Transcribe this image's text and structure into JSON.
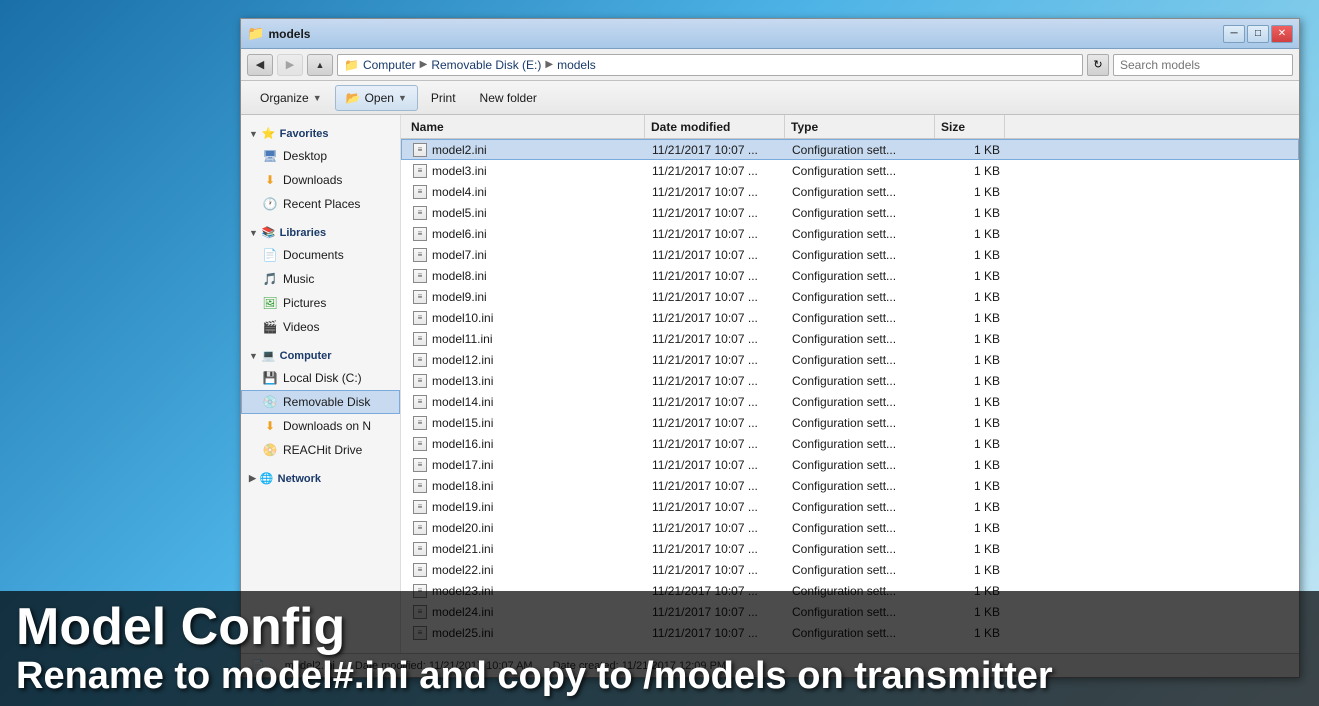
{
  "window": {
    "title": "models",
    "title_bar_title": "models"
  },
  "address": {
    "back_tooltip": "Back",
    "forward_tooltip": "Forward",
    "path": "Computer > Removable Disk (E:) > models",
    "path_segments": [
      "Computer",
      "Removable Disk (E:)",
      "models"
    ],
    "search_placeholder": "Search models",
    "refresh_label": "↻"
  },
  "toolbar": {
    "organize_label": "Organize",
    "open_label": "Open",
    "print_label": "Print",
    "new_folder_label": "New folder"
  },
  "sidebar": {
    "favorites_label": "Favorites",
    "favorites_items": [
      {
        "label": "Desktop",
        "icon": "desktop"
      },
      {
        "label": "Downloads",
        "icon": "downloads"
      },
      {
        "label": "Recent Places",
        "icon": "recent"
      }
    ],
    "libraries_label": "Libraries",
    "libraries_items": [
      {
        "label": "Documents",
        "icon": "docs"
      },
      {
        "label": "Music",
        "icon": "music"
      },
      {
        "label": "Pictures",
        "icon": "pictures"
      },
      {
        "label": "Videos",
        "icon": "videos"
      }
    ],
    "computer_label": "Computer",
    "computer_items": [
      {
        "label": "Local Disk (C:)",
        "icon": "local-disk"
      },
      {
        "label": "Removable Disk",
        "icon": "removable",
        "active": true
      },
      {
        "label": "Downloads on N",
        "icon": "downloads"
      },
      {
        "label": "REACHit Drive",
        "icon": "network"
      }
    ],
    "network_label": "Network"
  },
  "columns": {
    "name": "Name",
    "date_modified": "Date modified",
    "type": "Type",
    "size": "Size"
  },
  "files": [
    {
      "name": "model2.ini",
      "date": "11/21/2017 10:07 ...",
      "type": "Configuration sett...",
      "size": "1 KB",
      "selected": true
    },
    {
      "name": "model3.ini",
      "date": "11/21/2017 10:07 ...",
      "type": "Configuration sett...",
      "size": "1 KB"
    },
    {
      "name": "model4.ini",
      "date": "11/21/2017 10:07 ...",
      "type": "Configuration sett...",
      "size": "1 KB"
    },
    {
      "name": "model5.ini",
      "date": "11/21/2017 10:07 ...",
      "type": "Configuration sett...",
      "size": "1 KB"
    },
    {
      "name": "model6.ini",
      "date": "11/21/2017 10:07 ...",
      "type": "Configuration sett...",
      "size": "1 KB"
    },
    {
      "name": "model7.ini",
      "date": "11/21/2017 10:07 ...",
      "type": "Configuration sett...",
      "size": "1 KB"
    },
    {
      "name": "model8.ini",
      "date": "11/21/2017 10:07 ...",
      "type": "Configuration sett...",
      "size": "1 KB"
    },
    {
      "name": "model9.ini",
      "date": "11/21/2017 10:07 ...",
      "type": "Configuration sett...",
      "size": "1 KB"
    },
    {
      "name": "model10.ini",
      "date": "11/21/2017 10:07 ...",
      "type": "Configuration sett...",
      "size": "1 KB"
    },
    {
      "name": "model11.ini",
      "date": "11/21/2017 10:07 ...",
      "type": "Configuration sett...",
      "size": "1 KB"
    },
    {
      "name": "model12.ini",
      "date": "11/21/2017 10:07 ...",
      "type": "Configuration sett...",
      "size": "1 KB"
    },
    {
      "name": "model13.ini",
      "date": "11/21/2017 10:07 ...",
      "type": "Configuration sett...",
      "size": "1 KB"
    },
    {
      "name": "model14.ini",
      "date": "11/21/2017 10:07 ...",
      "type": "Configuration sett...",
      "size": "1 KB"
    },
    {
      "name": "model15.ini",
      "date": "11/21/2017 10:07 ...",
      "type": "Configuration sett...",
      "size": "1 KB"
    },
    {
      "name": "model16.ini",
      "date": "11/21/2017 10:07 ...",
      "type": "Configuration sett...",
      "size": "1 KB"
    },
    {
      "name": "model17.ini",
      "date": "11/21/2017 10:07 ...",
      "type": "Configuration sett...",
      "size": "1 KB"
    },
    {
      "name": "model18.ini",
      "date": "11/21/2017 10:07 ...",
      "type": "Configuration sett...",
      "size": "1 KB"
    },
    {
      "name": "model19.ini",
      "date": "11/21/2017 10:07 ...",
      "type": "Configuration sett...",
      "size": "1 KB"
    },
    {
      "name": "model20.ini",
      "date": "11/21/2017 10:07 ...",
      "type": "Configuration sett...",
      "size": "1 KB"
    },
    {
      "name": "model21.ini",
      "date": "11/21/2017 10:07 ...",
      "type": "Configuration sett...",
      "size": "1 KB"
    },
    {
      "name": "model22.ini",
      "date": "11/21/2017 10:07 ...",
      "type": "Configuration sett...",
      "size": "1 KB"
    },
    {
      "name": "model23.ini",
      "date": "11/21/2017 10:07 ...",
      "type": "Configuration sett...",
      "size": "1 KB"
    },
    {
      "name": "model24.ini",
      "date": "11/21/2017 10:07 ...",
      "type": "Configuration sett...",
      "size": "1 KB"
    },
    {
      "name": "model25.ini",
      "date": "11/21/2017 10:07 ...",
      "type": "Configuration sett...",
      "size": "1 KB"
    }
  ],
  "status_bar": {
    "file_label": "model2.ini",
    "date_modified": "Date modified: 11/21/2017 10:07 AM",
    "date_created": "Date created: 11/21/2017 12:09 PM"
  },
  "overlay": {
    "line1": "Model Config",
    "line2": "Rename to model#.ini and copy to /models on transmitter"
  }
}
